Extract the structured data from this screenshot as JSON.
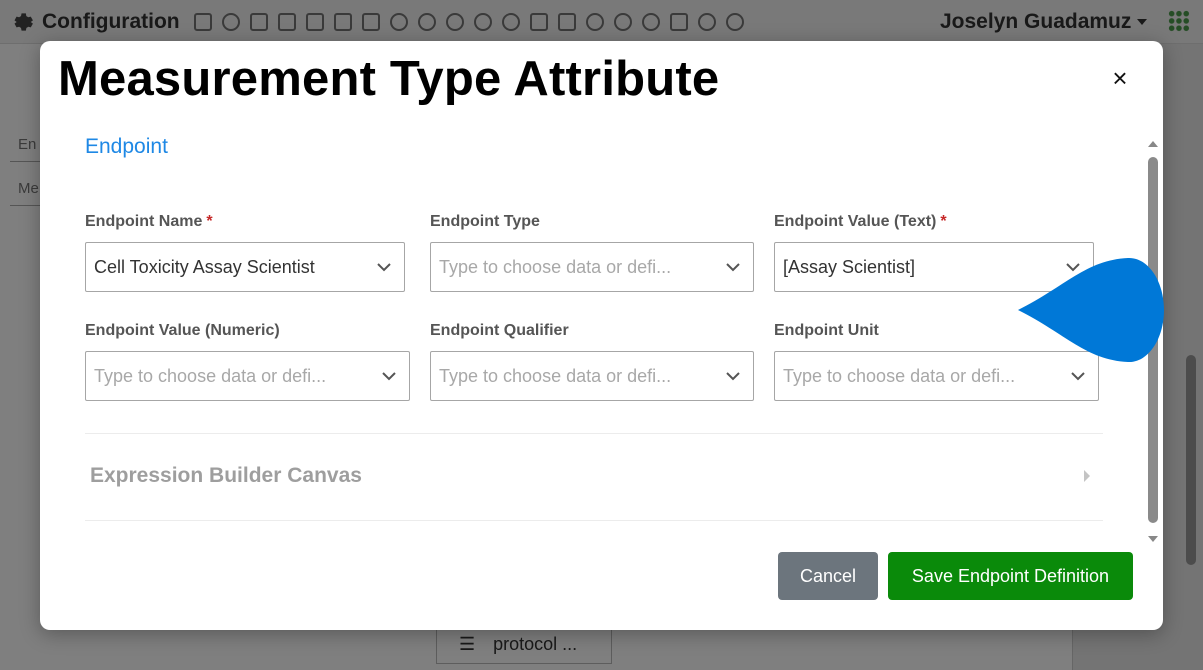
{
  "app": {
    "title": "Configuration",
    "user_name": "Joselyn Guadamuz",
    "bg_field_1": "En",
    "bg_field_2": "Me",
    "bg_bottom_item": "protocol ..."
  },
  "modal": {
    "title": "Measurement Type Attribute",
    "close_label": "×",
    "section_title": "Endpoint",
    "fields": {
      "endpoint_name": {
        "label": "Endpoint Name",
        "required_mark": "*",
        "value": "Cell Toxicity Assay Scientist"
      },
      "endpoint_type": {
        "label": "Endpoint Type",
        "placeholder": "Type to choose data or defi..."
      },
      "endpoint_value_text": {
        "label": "Endpoint Value (Text)",
        "required_mark": "*",
        "value": "[Assay Scientist]"
      },
      "endpoint_value_numeric": {
        "label": "Endpoint Value (Numeric)",
        "placeholder": "Type to choose data or defi..."
      },
      "endpoint_qualifier": {
        "label": "Endpoint Qualifier",
        "placeholder": "Type to choose data or defi..."
      },
      "endpoint_unit": {
        "label": "Endpoint Unit",
        "placeholder": "Type to choose data or defi..."
      }
    },
    "expression_builder_title": "Expression Builder Canvas",
    "buttons": {
      "cancel": "Cancel",
      "save": "Save Endpoint Definition"
    }
  },
  "colors": {
    "accent_blue": "#1e88e5",
    "save_green": "#0a8a0a",
    "cancel_gray": "#6c757d",
    "required_red": "#c62828",
    "teardrop_blue": "#0078d7"
  }
}
